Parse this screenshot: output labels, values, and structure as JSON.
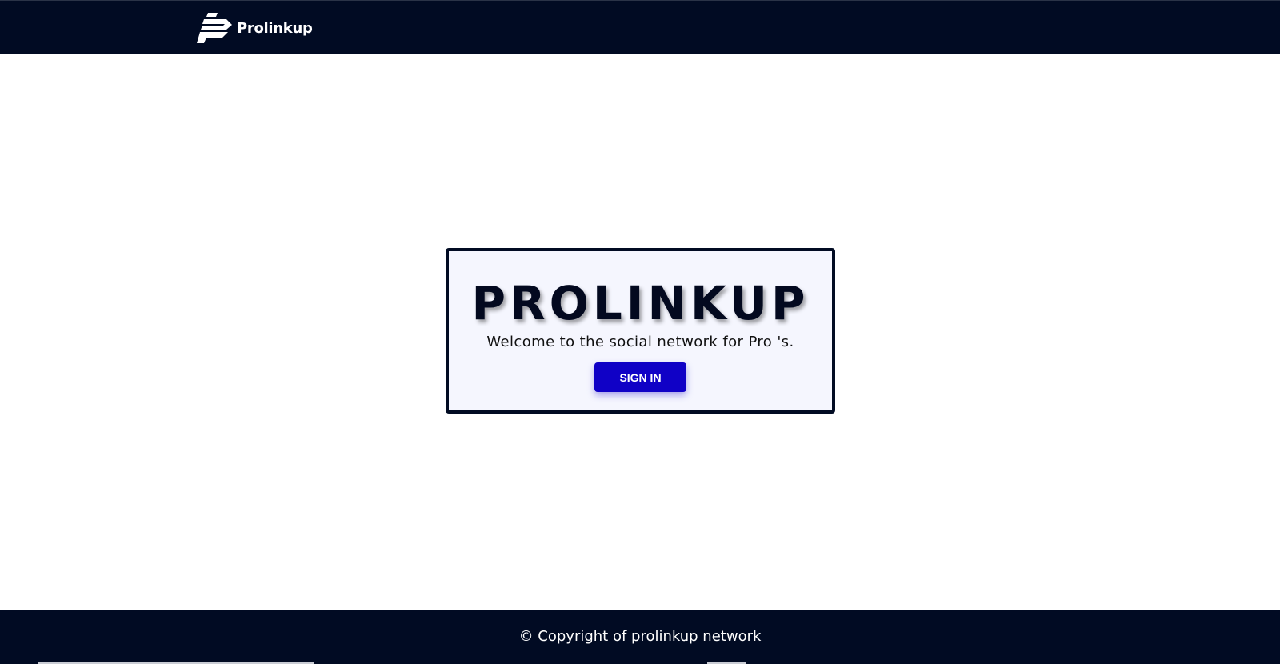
{
  "navbar": {
    "brand_name": "Prolinkup",
    "logo_icon": "prolinkup-logo-icon",
    "background_color": "#010b23"
  },
  "hero": {
    "title": "PROLINKUP",
    "subtitle": "Welcome to the social network for Pro 's.",
    "signin_label": "SIGN IN",
    "card_background": "#f5f6fe",
    "button_color": "#1001c6"
  },
  "footer": {
    "copyright_text": "© Copyright of prolinkup network",
    "background_color": "#010b23"
  }
}
